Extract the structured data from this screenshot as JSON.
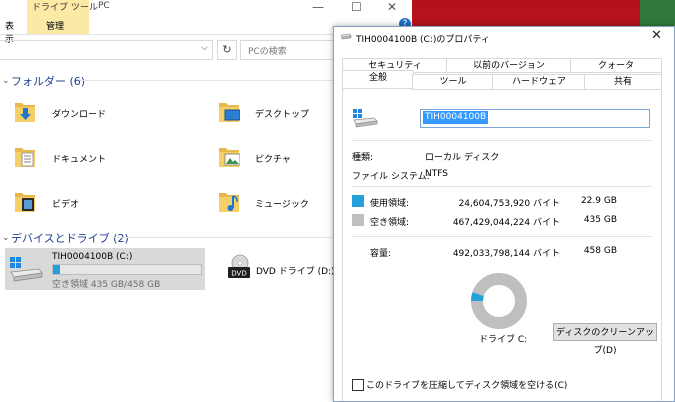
{
  "explorer": {
    "ribbon": {
      "drive_tools": "ドライブ ツール",
      "manage": "管理",
      "left_tab": "表示",
      "window_title": "PC"
    },
    "search_placeholder": "PCの検索",
    "folders_header": "フォルダー (6)",
    "folders": [
      {
        "label": "ダウンロード",
        "icon": "downloads-folder-icon"
      },
      {
        "label": "デスクトップ",
        "icon": "desktop-folder-icon"
      },
      {
        "label": "ドキュメント",
        "icon": "documents-folder-icon"
      },
      {
        "label": "ピクチャ",
        "icon": "pictures-folder-icon"
      },
      {
        "label": "ビデオ",
        "icon": "videos-folder-icon"
      },
      {
        "label": "ミュージック",
        "icon": "music-folder-icon"
      }
    ],
    "devices_header": "デバイスとドライブ (2)",
    "drive_c": {
      "name": "TIH0004100B (C:)",
      "free_text": "空き領域 435 GB/458 GB",
      "used_fraction": 0.05
    },
    "dvd": {
      "label": "DVD ドライブ (D:)",
      "icon_text": "DVD"
    }
  },
  "props": {
    "title": "TIH0004100B (C:)のプロパティ",
    "tabs_row1": [
      "セキュリティ",
      "以前のバージョン",
      "クォータ"
    ],
    "tabs_row2": [
      "全般",
      "ツール",
      "ハードウェア",
      "共有"
    ],
    "active_tab": "全般",
    "volume_name": "TIH0004100B",
    "type_label": "種類:",
    "type_value": "ローカル ディスク",
    "fs_label": "ファイル システム:",
    "fs_value": "NTFS",
    "used_label": "使用領域:",
    "used_bytes": "24,604,753,920 バイト",
    "used_gb": "22.9 GB",
    "free_label": "空き領域:",
    "free_bytes": "467,429,044,224 バイト",
    "free_gb": "435 GB",
    "capacity_label": "容量:",
    "capacity_bytes": "492,033,798,144 バイト",
    "capacity_gb": "458 GB",
    "drive_letter": "ドライブ C:",
    "cleanup_button": "ディスクのクリーンアップ(D)",
    "compress_label": "このドライブを圧縮してディスク領域を空ける(C)",
    "compress_checked": false,
    "used_fraction": 0.05,
    "colors": {
      "used": "#26a0da",
      "free": "#bfbfbf"
    }
  }
}
